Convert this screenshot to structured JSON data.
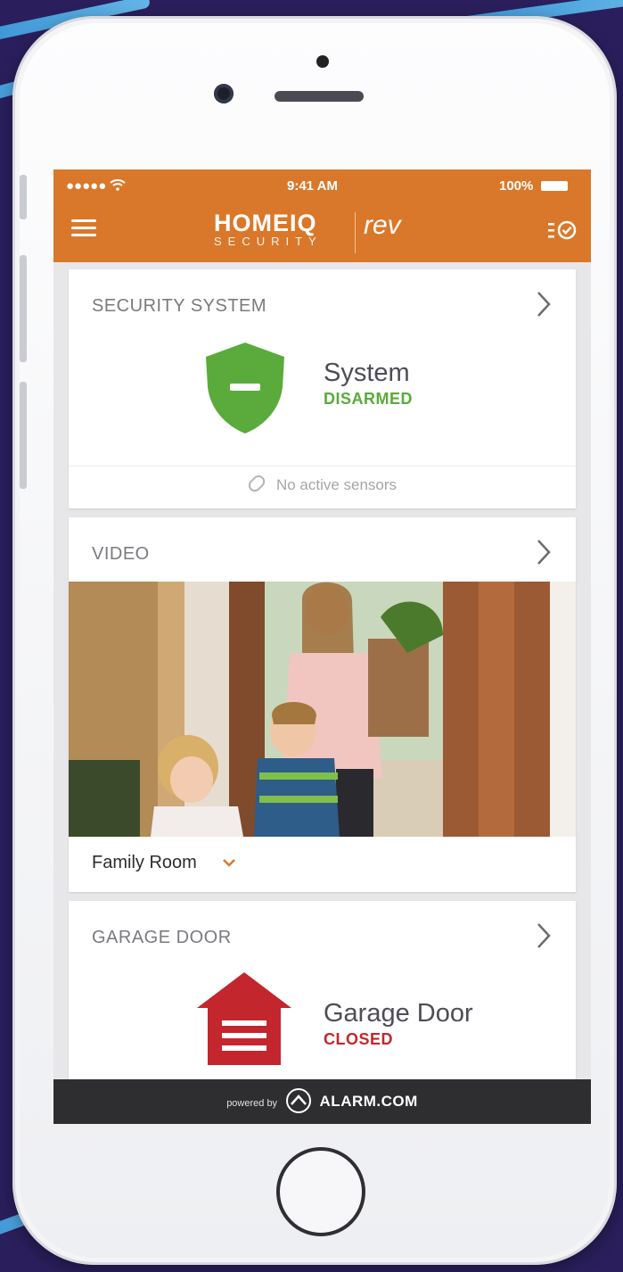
{
  "status_bar": {
    "signal": "●●●●● ",
    "time": "9:41 AM",
    "battery": "100%"
  },
  "header": {
    "brand_main": "HOMEIQ",
    "brand_sub": "SECURITY",
    "brand_partner": "rev"
  },
  "security": {
    "title": "SECURITY SYSTEM",
    "label": "System",
    "state": "DISARMED",
    "sensors": "No active sensors",
    "state_color": "#5aab3b"
  },
  "video": {
    "title": "VIDEO",
    "camera_name": "Family Room"
  },
  "garage": {
    "title": "GARAGE DOOR",
    "label": "Garage Door",
    "state": "CLOSED",
    "state_color": "#c4262e"
  },
  "footer": {
    "powered_by": "powered by",
    "brand": "ALARM.COM"
  },
  "colors": {
    "accent": "#d9782a",
    "secure_green": "#5aab3b",
    "alert_red": "#c4262e"
  }
}
